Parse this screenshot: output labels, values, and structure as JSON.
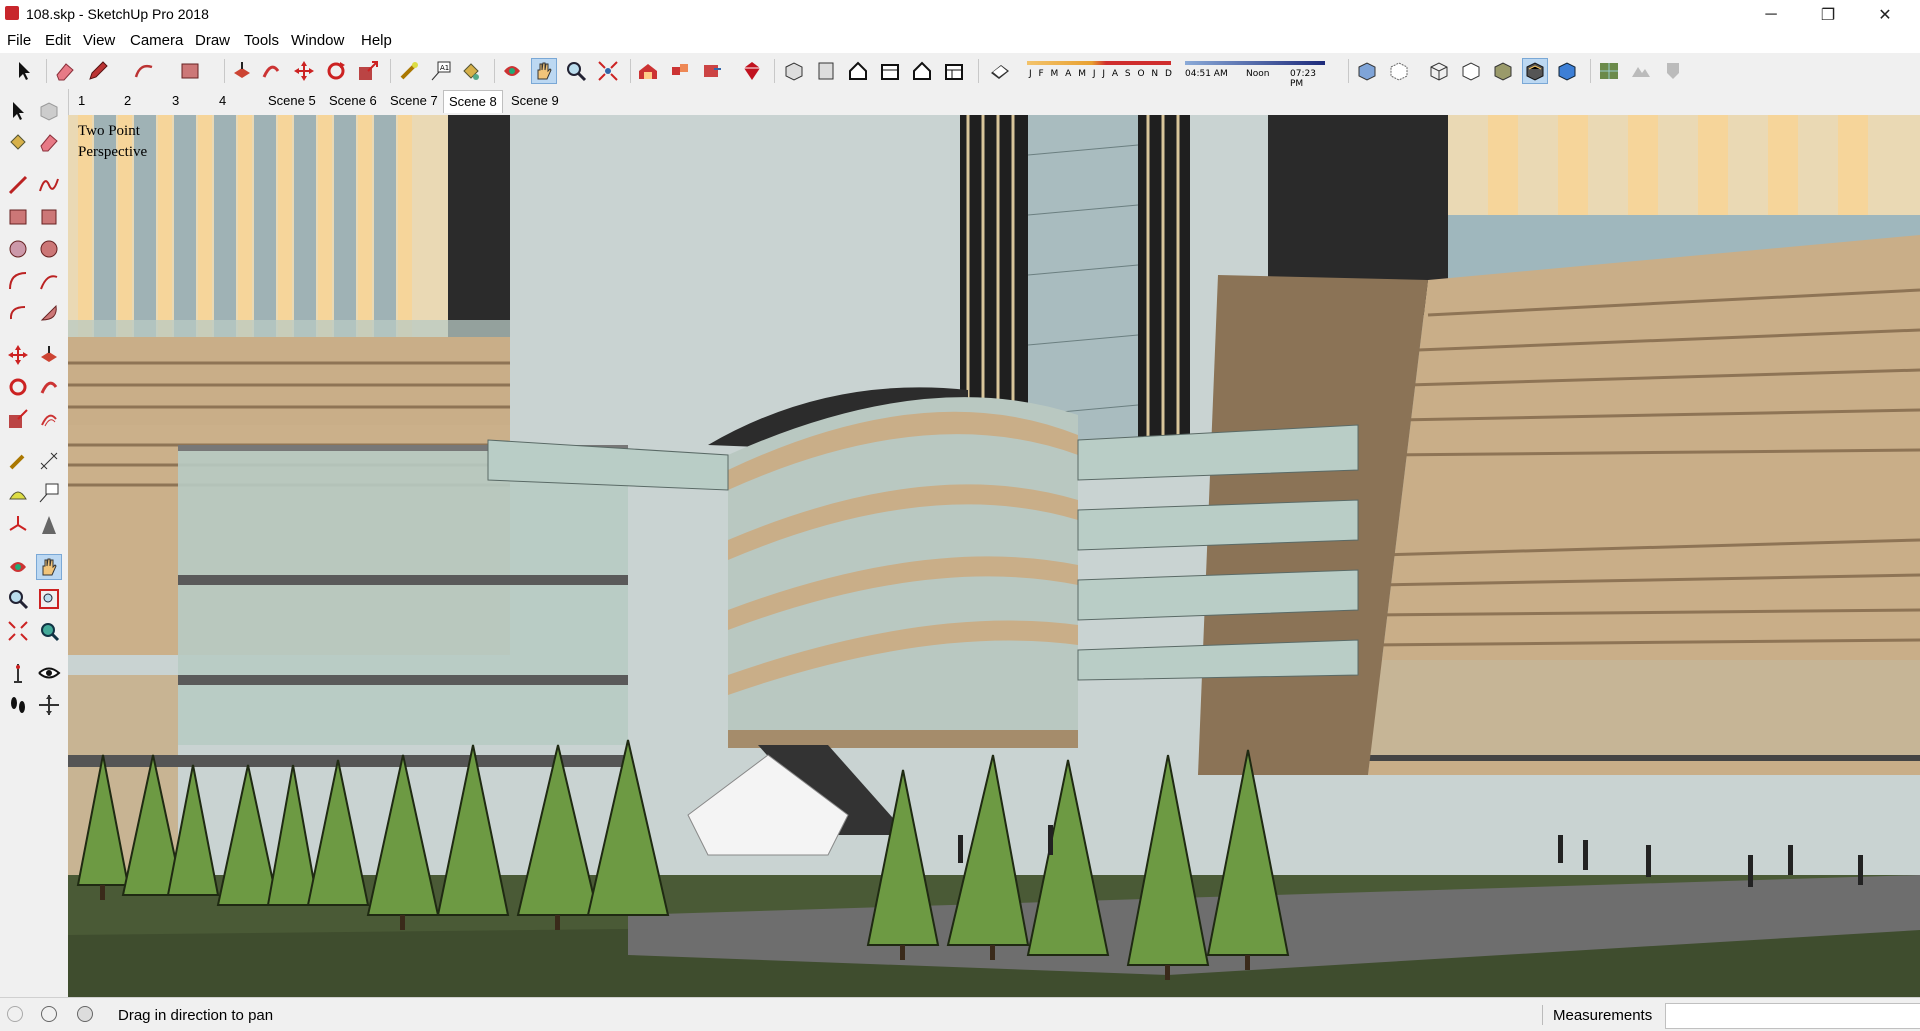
{
  "window": {
    "title": "108.skp - SketchUp Pro 2018"
  },
  "menu": [
    "File",
    "Edit",
    "View",
    "Camera",
    "Draw",
    "Tools",
    "Window",
    "Help"
  ],
  "shadows": {
    "months": "J F M A M J J A S O N D",
    "time_start": "04:51 AM",
    "time_mid": "Noon",
    "time_end": "07:23 PM"
  },
  "scenes": [
    "1",
    "2",
    "3",
    "4",
    "Scene 5",
    "Scene 6",
    "Scene 7",
    "Scene 8",
    "Scene 9"
  ],
  "active_scene": "Scene 8",
  "viewport": {
    "camera_mode_line1": "Two Point",
    "camera_mode_line2": "Perspective"
  },
  "status": {
    "hint": "Drag in direction to pan",
    "measurements_label": "Measurements",
    "measurements_value": ""
  },
  "colors": {
    "accent": "#c8262c",
    "toolbar_bg": "#f0f0f0",
    "sky": "#c9d3d2",
    "facade_wood": "#c9ae88",
    "tree_green": "#6d9a43",
    "glass": "#b7cbc3"
  }
}
